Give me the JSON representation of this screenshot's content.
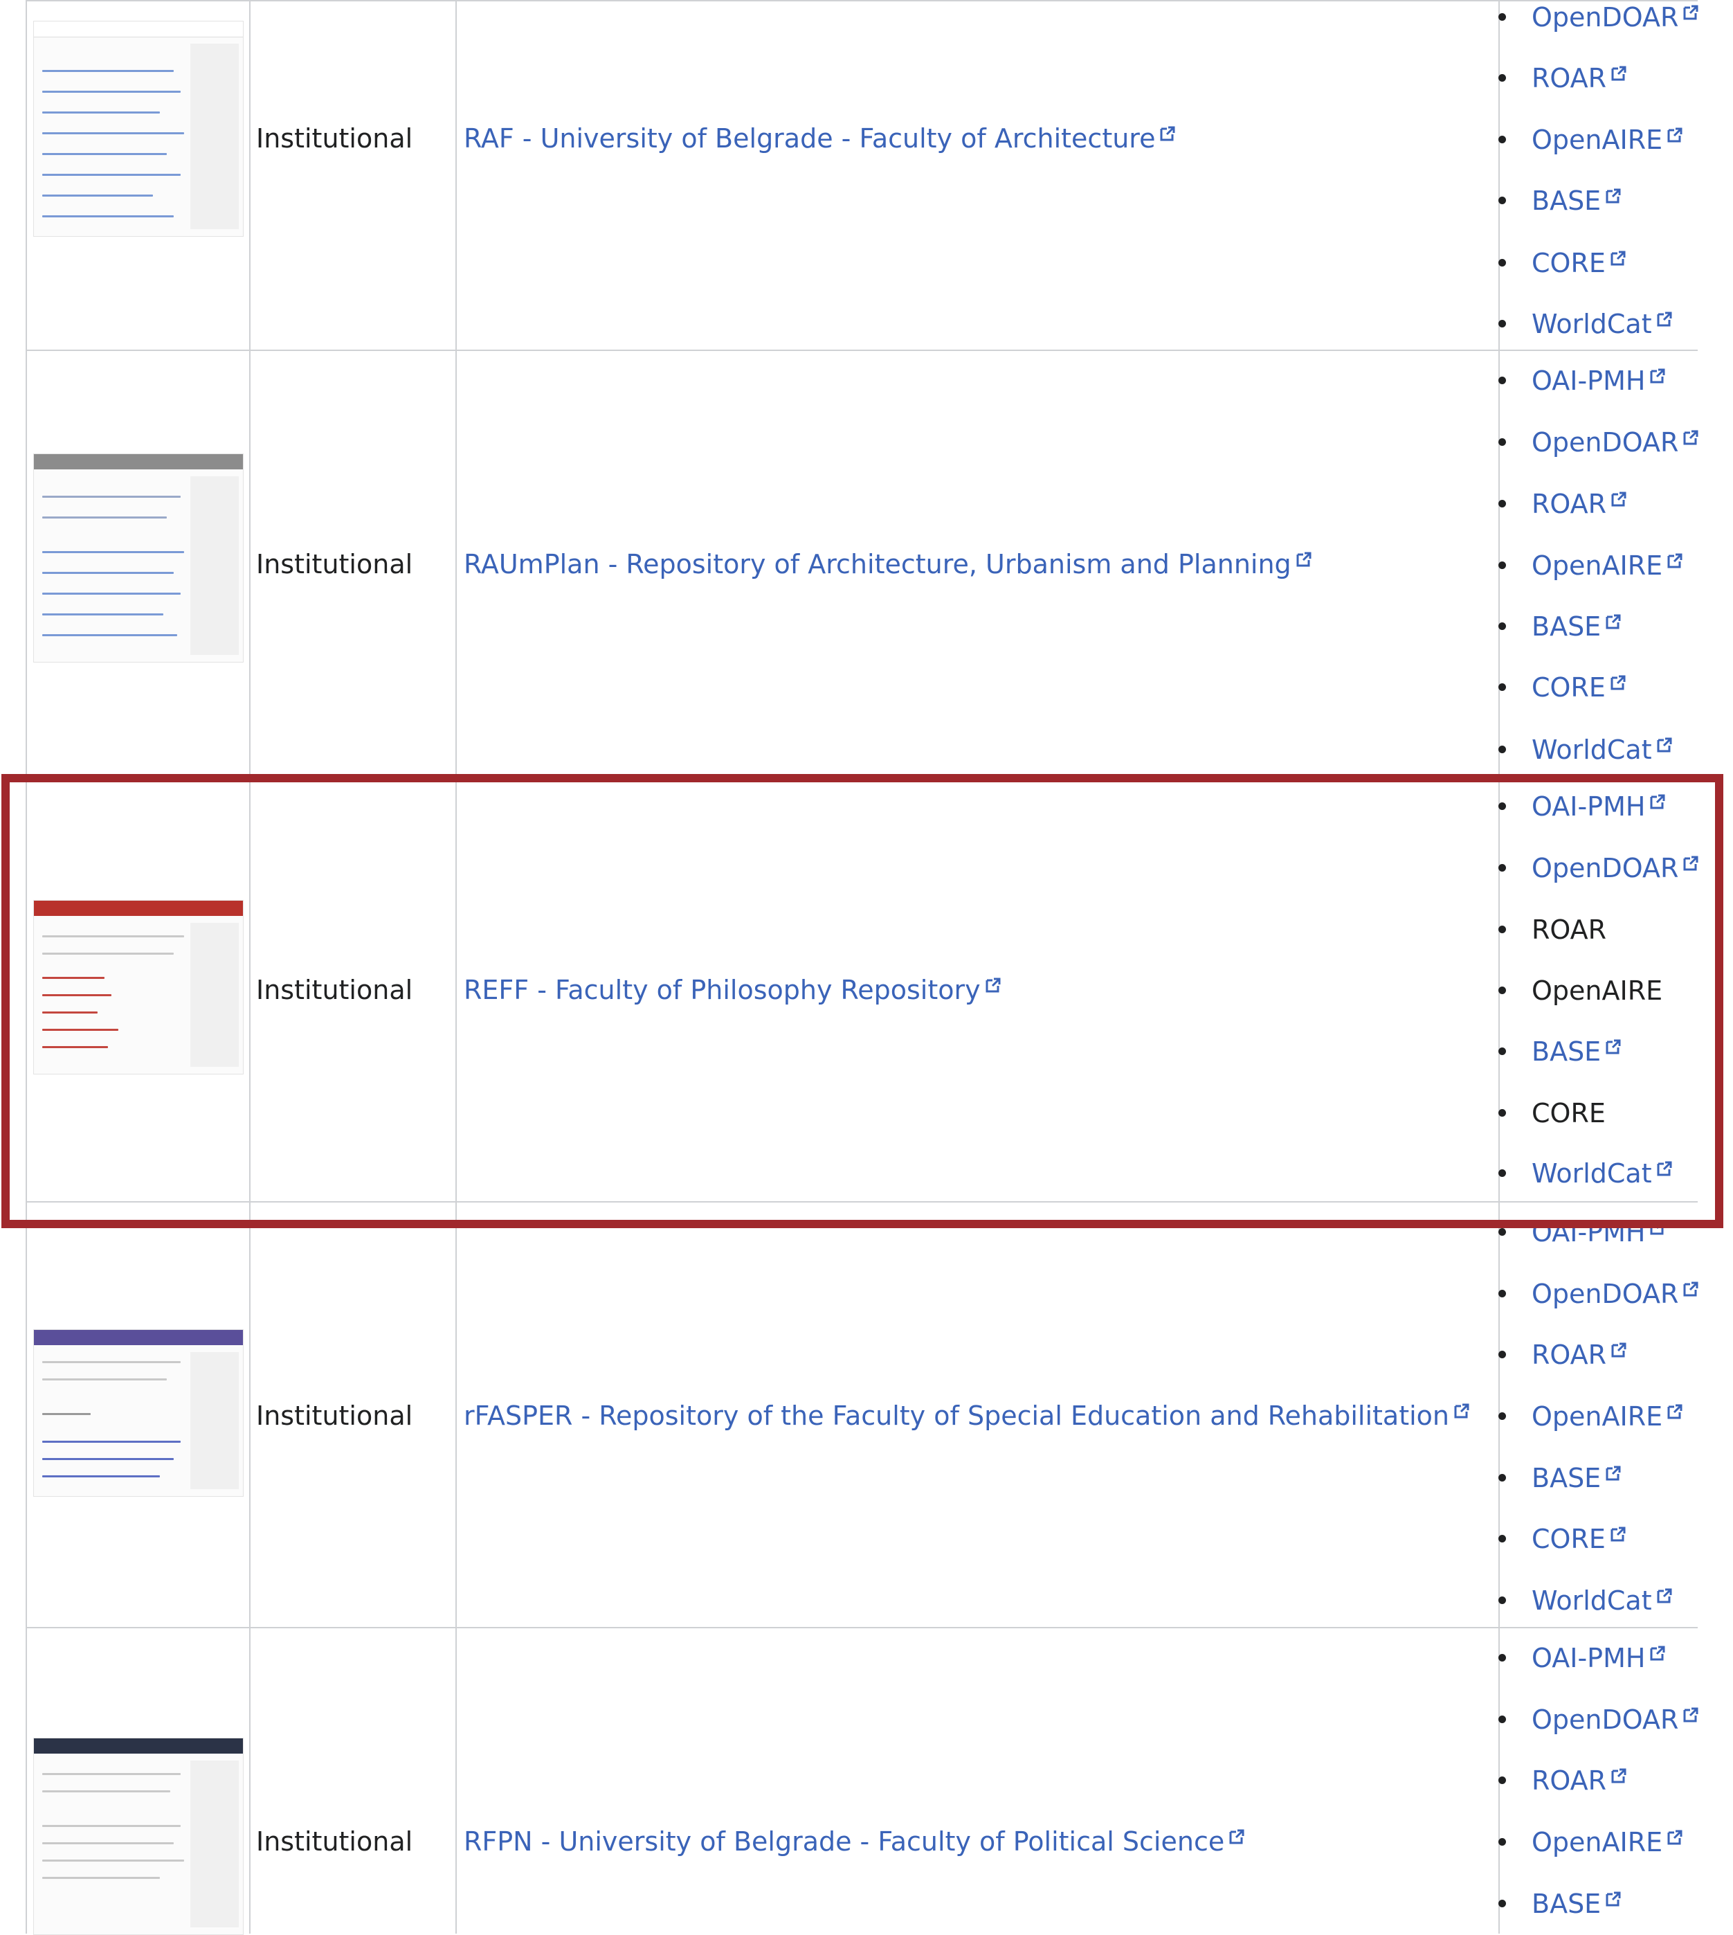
{
  "rows": [
    {
      "type": "Institutional",
      "name": "RAF - University of Belgrade - Faculty of Architecture",
      "services": [
        "OpenDOAR",
        "ROAR",
        "OpenAIRE",
        "BASE",
        "CORE",
        "WorldCat"
      ]
    },
    {
      "type": "Institutional",
      "name": "RAUmPlan - Repository of Architecture, Urbanism and Planning",
      "services": [
        "OAI-PMH",
        "OpenDOAR",
        "ROAR",
        "OpenAIRE",
        "BASE",
        "CORE",
        "WorldCat"
      ]
    },
    {
      "type": "Institutional",
      "name": "REFF - Faculty of Philosophy Repository",
      "services": [
        "OAI-PMH",
        "OpenDOAR",
        "ROAR",
        "OpenAIRE",
        "BASE",
        "CORE",
        "WorldCat"
      ]
    },
    {
      "type": "Institutional",
      "name": "rFASPER - Repository of the Faculty of Special Education and Rehabilitation",
      "services": [
        "OAI-PMH",
        "OpenDOAR",
        "ROAR",
        "OpenAIRE",
        "BASE",
        "CORE",
        "WorldCat"
      ]
    },
    {
      "type": "Institutional",
      "name": "RFPN - University of Belgrade - Faculty of Political Science",
      "services": [
        "OAI-PMH",
        "OpenDOAR",
        "ROAR",
        "OpenAIRE",
        "BASE"
      ]
    }
  ],
  "colors": {
    "link": "#3a63b8",
    "text": "#202122",
    "border": "#cfd1d4",
    "highlight": "#a0282c"
  },
  "icons": {
    "external_link": "external-link-icon",
    "bullet": "bullet-icon"
  }
}
